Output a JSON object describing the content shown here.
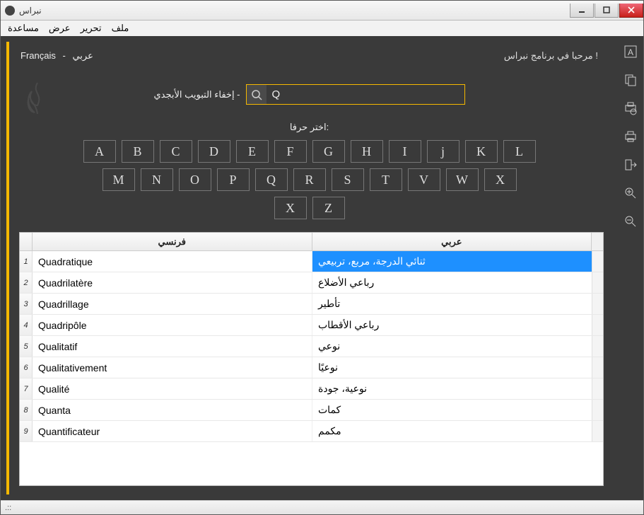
{
  "window": {
    "title": "نبراس"
  },
  "menu": {
    "file": "ملف",
    "edit": "تحرير",
    "view": "عرض",
    "help": "مساعدة"
  },
  "top": {
    "welcome": "مرحبا في برنامج نبراس !",
    "lang_fr": "Français",
    "lang_sep": "-",
    "lang_ar": "عربي",
    "hide_alpha": "إخفاء التبويب الأبجدي -",
    "search_value": "Q",
    "pick_letter": "اختر حرفا:"
  },
  "letters": {
    "row1": [
      "A",
      "B",
      "C",
      "D",
      "E",
      "F",
      "G",
      "H",
      "I",
      "j",
      "K",
      "L"
    ],
    "row2": [
      "M",
      "N",
      "O",
      "P",
      "Q",
      "R",
      "S",
      "T",
      "V",
      "W",
      "X"
    ],
    "row3": [
      "X",
      "Z"
    ]
  },
  "table": {
    "headers": {
      "fr": "فرنسي",
      "ar": "عربي"
    },
    "rows": [
      {
        "n": "1",
        "fr": "Quadratique",
        "ar": "ثنائي الدرجة، مربع، تربيعي",
        "selected": true
      },
      {
        "n": "2",
        "fr": "Quadrilatère",
        "ar": "رباعي الأضلاع"
      },
      {
        "n": "3",
        "fr": "Quadrillage",
        "ar": "تأطير"
      },
      {
        "n": "4",
        "fr": "Quadripôle",
        "ar": "رباعي الأقطاب"
      },
      {
        "n": "5",
        "fr": "Qualitatif",
        "ar": "نوعي"
      },
      {
        "n": "6",
        "fr": "Qualitativement",
        "ar": "نوعيًا"
      },
      {
        "n": "7",
        "fr": "Qualité",
        "ar": "نوعية، جودة"
      },
      {
        "n": "8",
        "fr": "Quanta",
        "ar": "كمات"
      },
      {
        "n": "9",
        "fr": "Quantificateur",
        "ar": "مكمم"
      }
    ]
  },
  "status": ".::"
}
